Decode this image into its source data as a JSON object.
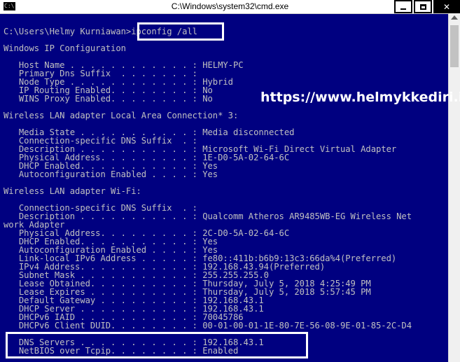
{
  "window": {
    "title": "C:\\Windows\\system32\\cmd.exe",
    "icon_label": "C:\\",
    "minimize_icon": "minimize-icon",
    "maximize_icon": "maximize-icon",
    "close_label": "✕"
  },
  "watermark": "https://www.helmykkediri.id/",
  "console": {
    "lines": [
      "C:\\Users\\Helmy Kurniawan>ipconfig /all",
      "",
      "Windows IP Configuration",
      "",
      "   Host Name . . . . . . . . . . . . : HELMY-PC",
      "   Primary Dns Suffix  . . . . . . . :",
      "   Node Type . . . . . . . . . . . . : Hybrid",
      "   IP Routing Enabled. . . . . . . . : No",
      "   WINS Proxy Enabled. . . . . . . . : No",
      "",
      "Wireless LAN adapter Local Area Connection* 3:",
      "",
      "   Media State . . . . . . . . . . . : Media disconnected",
      "   Connection-specific DNS Suffix  . :",
      "   Description . . . . . . . . . . . : Microsoft Wi-Fi Direct Virtual Adapter",
      "   Physical Address. . . . . . . . . : 1E-D0-5A-02-64-6C",
      "   DHCP Enabled. . . . . . . . . . . : Yes",
      "   Autoconfiguration Enabled . . . . : Yes",
      "",
      "Wireless LAN adapter Wi-Fi:",
      "",
      "   Connection-specific DNS Suffix  . :",
      "   Description . . . . . . . . . . . : Qualcomm Atheros AR9485WB-EG Wireless Net",
      "work Adapter",
      "   Physical Address. . . . . . . . . : 2C-D0-5A-02-64-6C",
      "   DHCP Enabled. . . . . . . . . . . : Yes",
      "   Autoconfiguration Enabled . . . . : Yes",
      "   Link-local IPv6 Address . . . . . : fe80::411b:b6b9:13c3:66da%4(Preferred)",
      "   IPv4 Address. . . . . . . . . . . : 192.168.43.94(Preferred)",
      "   Subnet Mask . . . . . . . . . . . : 255.255.255.0",
      "   Lease Obtained. . . . . . . . . . : Thursday, July 5, 2018 4:25:49 PM",
      "   Lease Expires . . . . . . . . . . : Thursday, July 5, 2018 5:57:45 PM",
      "   Default Gateway . . . . . . . . . : 192.168.43.1",
      "   DHCP Server . . . . . . . . . . . : 192.168.43.1",
      "   DHCPv6 IAID . . . . . . . . . . . : 70045786",
      "   DHCPv6 Client DUID. . . . . . . . : 00-01-00-01-1E-80-7E-56-08-9E-01-85-2C-D4",
      "",
      "   DNS Servers . . . . . . . . . . . : 192.168.43.1",
      "   NetBIOS over Tcpip. . . . . . . . : Enabled"
    ]
  }
}
